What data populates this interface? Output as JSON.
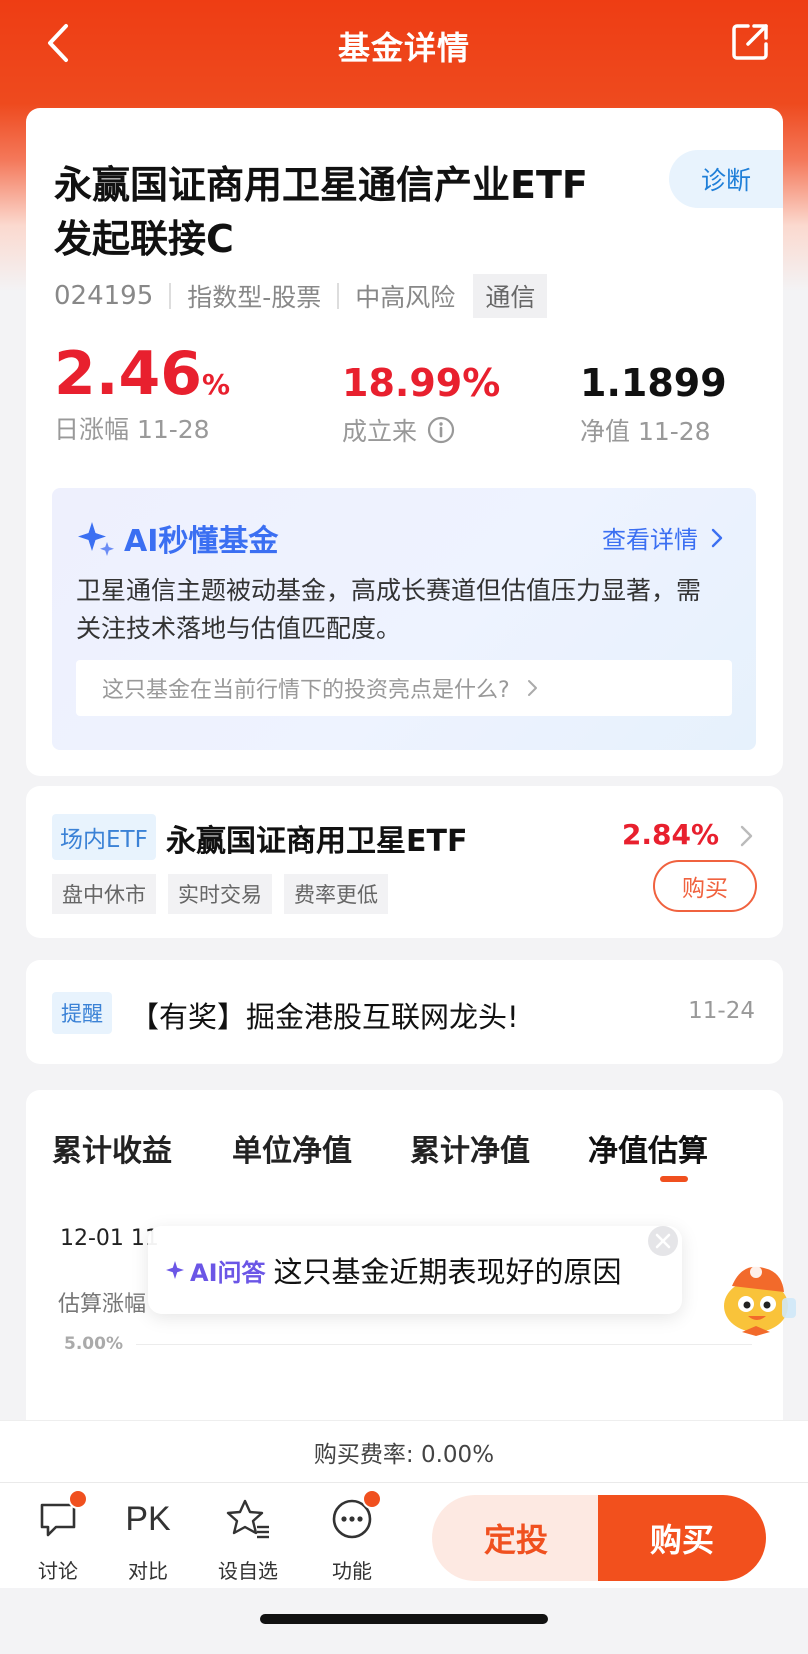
{
  "header": {
    "title": "基金详情",
    "back_icon": "chevron-left-icon",
    "share_icon": "share-icon"
  },
  "fund": {
    "name": "永赢国证商用卫星通信产业ETF发起联接C",
    "diagnose_label": "诊断",
    "code": "024195",
    "type": "指数型-股票",
    "risk": "中高风险",
    "industry": "通信",
    "daily_change": "2.46",
    "daily_change_unit": "%",
    "daily_change_label": "日涨幅 11-28",
    "since_inception": "18.99%",
    "since_inception_label": "成立来",
    "nav": "1.1899",
    "nav_label": "净值 11-28"
  },
  "ai_card": {
    "title": "AI秒懂基金",
    "more_label": "查看详情",
    "description": "卫星通信主题被动基金，高成长赛道但估值压力显著，需关注技术落地与估值匹配度。",
    "question": "这只基金在当前行情下的投资亮点是什么?"
  },
  "etf": {
    "badge": "场内ETF",
    "name": "永赢国证商用卫星ETF",
    "change": "2.84%",
    "tags": [
      "盘中休市",
      "实时交易",
      "费率更低"
    ],
    "buy_label": "购买"
  },
  "reminder": {
    "badge": "提醒",
    "text": "【有奖】掘金港股互联网龙头!",
    "date": "11-24"
  },
  "chart_section": {
    "tabs": [
      "累计收益",
      "单位净值",
      "累计净值",
      "净值估算"
    ],
    "active_tab": "净值估算",
    "date_label": "12-01 11",
    "est_label": "估算涨幅",
    "y_tick": "5.00%"
  },
  "ai_popup": {
    "tag": "AI问答",
    "question": "这只基金近期表现好的原因"
  },
  "fee": {
    "text": "购买费率: 0.00%"
  },
  "bottom_nav": {
    "items": [
      {
        "label": "讨论",
        "icon": "chat-icon"
      },
      {
        "label": "对比",
        "icon": "PK"
      },
      {
        "label": "设自选",
        "icon": "star-list-icon"
      },
      {
        "label": "功能",
        "icon": "more-icon"
      }
    ],
    "sip_label": "定投",
    "buy_label": "购买"
  },
  "colors": {
    "brand": "#ee3d14",
    "up": "#e8202e",
    "ai_blue": "#3b6ff2",
    "link_blue": "#3b82d6"
  }
}
